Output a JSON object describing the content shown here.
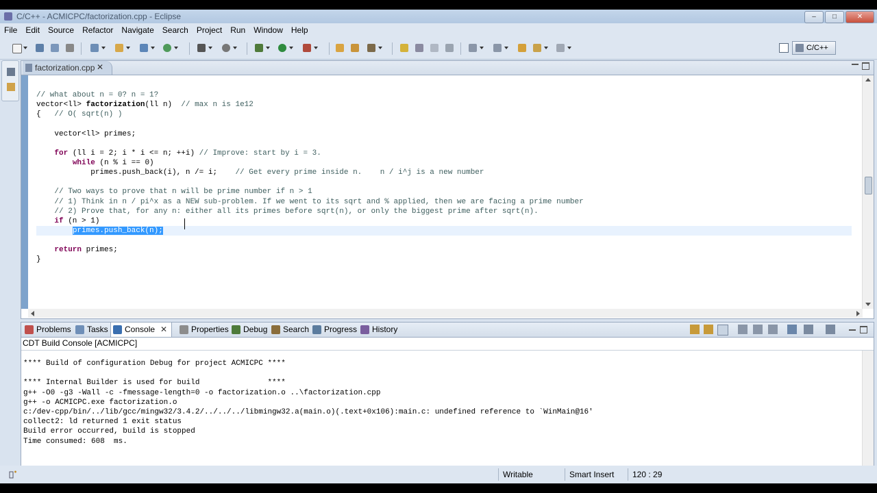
{
  "window": {
    "title": "C/C++ - ACMICPC/factorization.cpp - Eclipse",
    "buttons": {
      "minimize": "–",
      "maximize": "□",
      "close": "✕"
    }
  },
  "menu": [
    "File",
    "Edit",
    "Source",
    "Refactor",
    "Navigate",
    "Search",
    "Project",
    "Run",
    "Window",
    "Help"
  ],
  "perspective": {
    "label": "C/C++"
  },
  "editor": {
    "tab_label": "factorization.cpp",
    "tab_close": "✕",
    "lines": [
      {
        "parts": [
          {
            "t": "// what about n = 0? n = 1?",
            "c": "comment"
          }
        ]
      },
      {
        "parts": [
          {
            "t": "vector<ll> ",
            "c": ""
          },
          {
            "t": "factorization",
            "c": "fn"
          },
          {
            "t": "(ll n)  ",
            "c": ""
          },
          {
            "t": "// max n is 1e12",
            "c": "comment"
          }
        ]
      },
      {
        "parts": [
          {
            "t": "{   ",
            "c": ""
          },
          {
            "t": "// O( sqrt(n) )",
            "c": "comment"
          }
        ]
      },
      {
        "parts": [
          {
            "t": "",
            "c": ""
          }
        ]
      },
      {
        "parts": [
          {
            "t": "    vector<ll> primes;",
            "c": ""
          }
        ]
      },
      {
        "parts": [
          {
            "t": "",
            "c": ""
          }
        ]
      },
      {
        "parts": [
          {
            "t": "    ",
            "c": ""
          },
          {
            "t": "for",
            "c": "kw"
          },
          {
            "t": " (ll i = 2; i * i <= n; ++i) ",
            "c": ""
          },
          {
            "t": "// Improve: start by i = 3.",
            "c": "comment"
          }
        ]
      },
      {
        "parts": [
          {
            "t": "        ",
            "c": ""
          },
          {
            "t": "while",
            "c": "kw"
          },
          {
            "t": " (n % i == 0)",
            "c": ""
          }
        ]
      },
      {
        "parts": [
          {
            "t": "            primes.push_back(i), n /= i;    ",
            "c": ""
          },
          {
            "t": "// Get every prime inside n.    n / i^j is a new number",
            "c": "comment"
          }
        ]
      },
      {
        "parts": [
          {
            "t": "",
            "c": ""
          }
        ]
      },
      {
        "parts": [
          {
            "t": "    ",
            "c": ""
          },
          {
            "t": "// Two ways to prove that n will be prime number if n > 1",
            "c": "comment"
          }
        ]
      },
      {
        "parts": [
          {
            "t": "    ",
            "c": ""
          },
          {
            "t": "// 1) Think in n / pi^x as a NEW sub-problem. If we went to its sqrt and % applied, then we are facing a prime number",
            "c": "comment"
          }
        ]
      },
      {
        "parts": [
          {
            "t": "    ",
            "c": ""
          },
          {
            "t": "// 2) Prove that, for any n: either all its primes before sqrt(n), or only the biggest prime after sqrt(n).",
            "c": "comment"
          }
        ]
      },
      {
        "parts": [
          {
            "t": "    ",
            "c": ""
          },
          {
            "t": "if",
            "c": "kw"
          },
          {
            "t": " (n > 1)",
            "c": ""
          }
        ]
      },
      {
        "parts": [
          {
            "t": "        ",
            "c": ""
          },
          {
            "t": "primes.push_back(n);",
            "c": "sel"
          }
        ],
        "highlight": true
      },
      {
        "parts": [
          {
            "t": "",
            "c": ""
          }
        ]
      },
      {
        "parts": [
          {
            "t": "    ",
            "c": ""
          },
          {
            "t": "return",
            "c": "kw"
          },
          {
            "t": " primes;",
            "c": ""
          }
        ]
      },
      {
        "parts": [
          {
            "t": "}",
            "c": ""
          }
        ]
      }
    ]
  },
  "panel": {
    "tabs": [
      {
        "label": "Problems",
        "icon": "problems-icon",
        "color": "#c0504d"
      },
      {
        "label": "Tasks",
        "icon": "tasks-icon",
        "color": "#6f8fb8"
      },
      {
        "label": "Console",
        "icon": "console-icon",
        "color": "#3a6fb0",
        "active": true
      },
      {
        "label": "Properties",
        "icon": "properties-icon",
        "color": "#8c8c8c"
      },
      {
        "label": "Debug",
        "icon": "debug-icon",
        "color": "#4d7a3a"
      },
      {
        "label": "Search",
        "icon": "search-icon",
        "color": "#8a6d3b"
      },
      {
        "label": "Progress",
        "icon": "progress-icon",
        "color": "#5b7c9e"
      },
      {
        "label": "History",
        "icon": "history-icon",
        "color": "#7a5e9e"
      }
    ],
    "console_close": "✕",
    "console_title": "CDT Build Console [ACMICPC]",
    "console_lines": [
      "**** Build of configuration Debug for project ACMICPC ****",
      "",
      "**** Internal Builder is used for build               ****",
      "g++ -O0 -g3 -Wall -c -fmessage-length=0 -o factorization.o ..\\factorization.cpp",
      "g++ -o ACMICPC.exe factorization.o",
      "c:/dev-cpp/bin/../lib/gcc/mingw32/3.4.2/../../../libmingw32.a(main.o)(.text+0x106):main.c: undefined reference to `WinMain@16'",
      "collect2: ld returned 1 exit status",
      "Build error occurred, build is stopped",
      "Time consumed: 608  ms."
    ]
  },
  "status": {
    "writable": "Writable",
    "insert_mode": "Smart Insert",
    "position": "120 : 29"
  }
}
